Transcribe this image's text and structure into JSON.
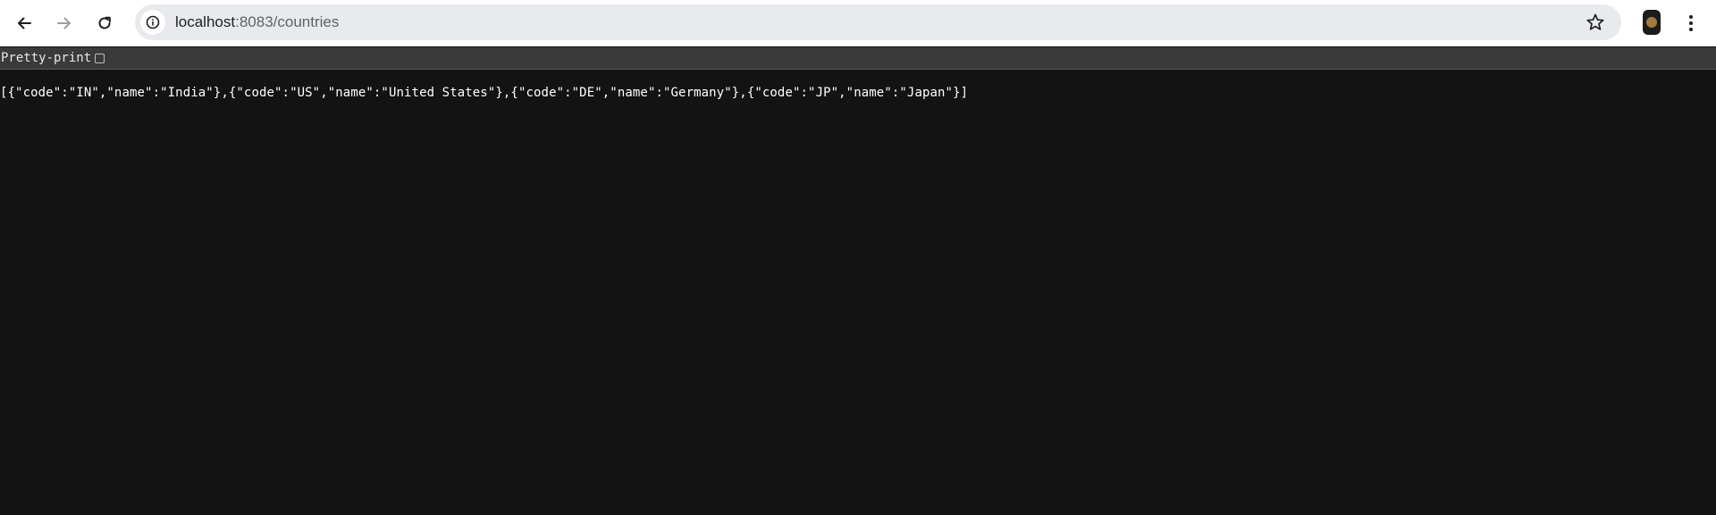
{
  "browser": {
    "url_host": "localhost",
    "url_rest": ":8083/countries",
    "back_icon": "arrow-left-icon",
    "forward_icon": "arrow-right-icon",
    "reload_icon": "reload-icon",
    "info_icon": "info-icon",
    "star_icon": "star-icon",
    "menu_icon": "kebab-menu-icon"
  },
  "viewer": {
    "pretty_print_label": "Pretty-print",
    "pretty_print_checked": false,
    "raw_json": "[{\"code\":\"IN\",\"name\":\"India\"},{\"code\":\"US\",\"name\":\"United States\"},{\"code\":\"DE\",\"name\":\"Germany\"},{\"code\":\"JP\",\"name\":\"Japan\"}]"
  },
  "colors": {
    "page_background": "#131313",
    "toolbar_background": "#ffffff",
    "omnibox_background": "#e8eaed",
    "pretty_bar_background": "#3a3a3a",
    "json_text": "#ffffff"
  }
}
